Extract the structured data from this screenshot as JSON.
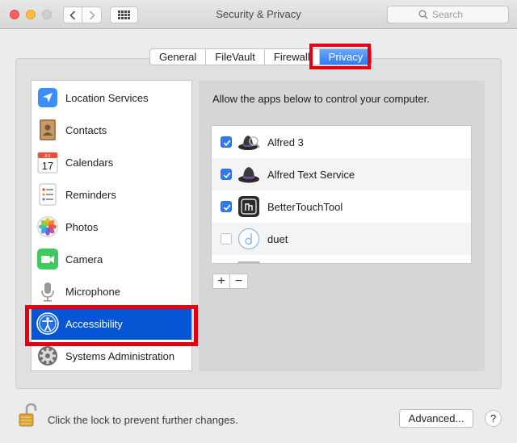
{
  "window": {
    "title": "Security & Privacy",
    "search_placeholder": "Search"
  },
  "tabs": [
    {
      "label": "General",
      "active": false
    },
    {
      "label": "FileVault",
      "active": false
    },
    {
      "label": "Firewall",
      "active": false
    },
    {
      "label": "Privacy",
      "active": true
    }
  ],
  "sidebar": {
    "items": [
      {
        "label": "Location Services",
        "icon": "location-arrow-icon"
      },
      {
        "label": "Contacts",
        "icon": "contacts-book-icon"
      },
      {
        "label": "Calendars",
        "icon": "calendar-icon",
        "icon_text": "17",
        "icon_month": "JUL"
      },
      {
        "label": "Reminders",
        "icon": "reminders-list-icon"
      },
      {
        "label": "Photos",
        "icon": "photos-flower-icon"
      },
      {
        "label": "Camera",
        "icon": "camera-icon"
      },
      {
        "label": "Microphone",
        "icon": "microphone-icon"
      },
      {
        "label": "Accessibility",
        "icon": "accessibility-person-icon",
        "selected": true
      },
      {
        "label": "Systems Administration",
        "icon": "gear-icon"
      }
    ]
  },
  "main": {
    "instruction": "Allow the apps below to control your computer.",
    "apps": [
      {
        "name": "Alfred 3",
        "checked": true,
        "icon": "alfred-hat-icon"
      },
      {
        "name": "Alfred Text Service",
        "checked": true,
        "icon": "alfred-text-hat-icon"
      },
      {
        "name": "BetterTouchTool",
        "checked": true,
        "icon": "bettertouchtool-icon"
      },
      {
        "name": "duet",
        "checked": false,
        "icon": "duet-icon"
      }
    ],
    "add_label": "+",
    "remove_label": "−"
  },
  "footer": {
    "lock_text": "Click the lock to prevent further changes.",
    "advanced_label": "Advanced...",
    "help_label": "?"
  },
  "colors": {
    "accent": "#2f7af5",
    "selection": "#0655d5",
    "highlight_box": "#e6000f"
  }
}
